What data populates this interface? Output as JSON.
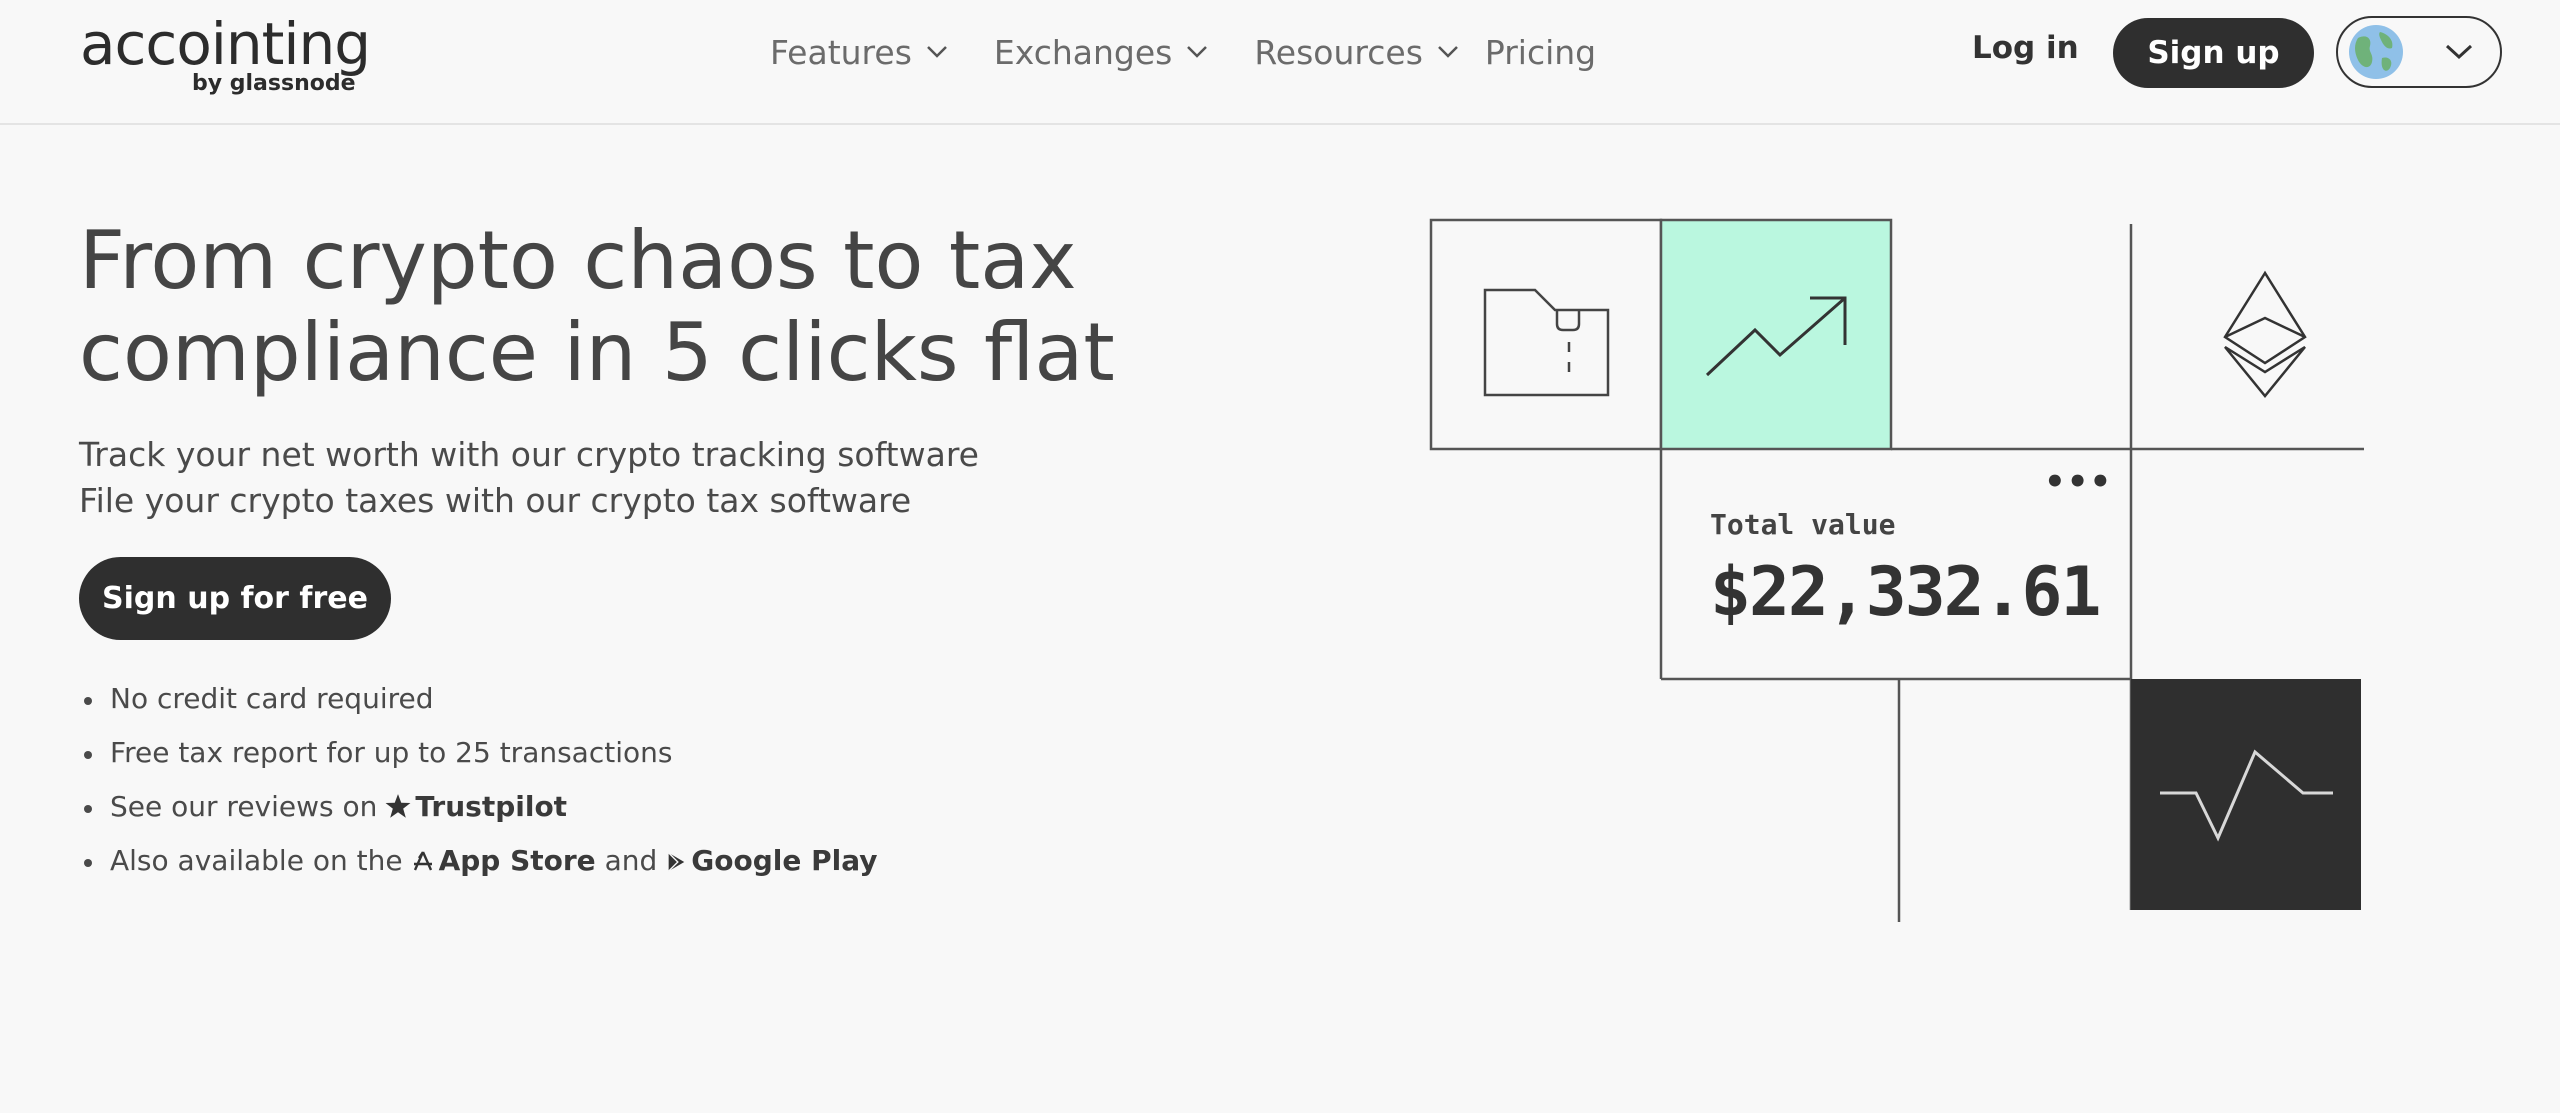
{
  "header": {
    "logo_main": "accointing",
    "logo_sub": "by glassnode",
    "nav": [
      {
        "label": "Features",
        "has_dropdown": true
      },
      {
        "label": "Exchanges",
        "has_dropdown": true
      },
      {
        "label": "Resources",
        "has_dropdown": true
      },
      {
        "label": "Pricing",
        "has_dropdown": false
      }
    ],
    "login_label": "Log in",
    "signup_label": "Sign up",
    "language_icon": "globe-icon"
  },
  "hero": {
    "title_line1": "From crypto chaos to tax",
    "title_line2": "compliance in 5 clicks flat",
    "sub_line1": "Track your net worth with our crypto tracking software",
    "sub_line2": "File your crypto taxes with our crypto tax software",
    "cta_label": "Sign up for free",
    "bullets": {
      "b1": "No credit card required",
      "b2": "Free tax report for up to 25 transactions",
      "b3_prefix": "See our reviews on",
      "b3_link": "Trustpilot",
      "b4_prefix": "Also available on the",
      "b4_link1": "App Store",
      "b4_and": "and",
      "b4_link2": "Google Play"
    }
  },
  "illustration": {
    "total_label": "Total value",
    "total_value": "$22,332.61",
    "more_label": "•••",
    "accent_color": "#baf7df",
    "dark_tile_color": "#2f2f2f",
    "icons": [
      "folder-icon",
      "trend-up-icon",
      "ethereum-icon",
      "pulse-icon"
    ]
  }
}
